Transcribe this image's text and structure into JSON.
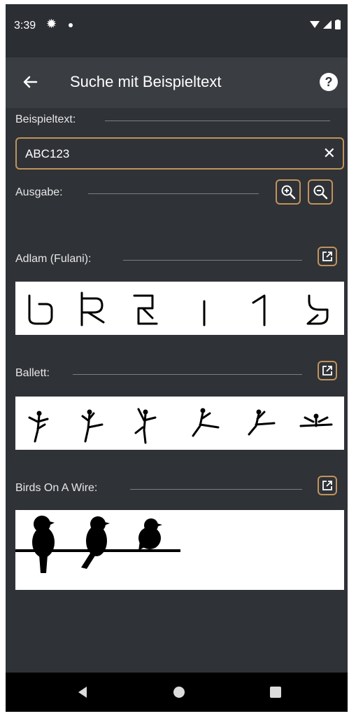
{
  "status_bar": {
    "time": "3:39"
  },
  "app_bar": {
    "title": "Suche mit Beispieltext"
  },
  "sample_text": {
    "label": "Beispieltext:",
    "value": "ABC123"
  },
  "output": {
    "label": "Ausgabe:"
  },
  "fonts": [
    {
      "name": "Adlam (Fulani):",
      "glyphs": [
        "𞤄",
        "𞤇",
        "𞤇",
        "𞥑",
        "𞥒",
        "𞥓"
      ]
    },
    {
      "name": "Ballett:"
    },
    {
      "name": "Birds On A Wire:"
    }
  ],
  "colors": {
    "background": "#2f3237",
    "appbar": "#3a3d42",
    "accent_border": "#c0935b",
    "preview_bg": "#ffffff"
  }
}
